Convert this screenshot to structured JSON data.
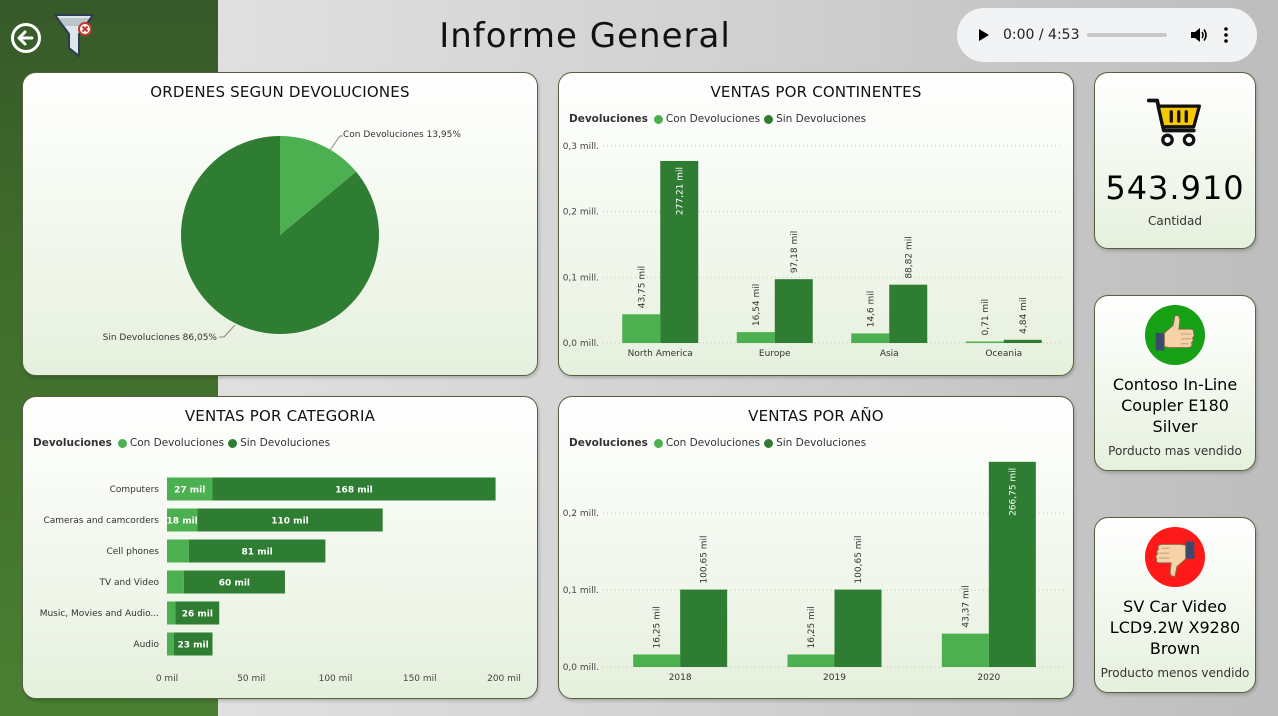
{
  "page": {
    "title": "Informe General"
  },
  "audio": {
    "time": "0:00 / 4:53",
    "progress": 0
  },
  "pie_card": {
    "title": "ORDENES SEGUN DEVOLUCIONES",
    "label_con": "Con Devoluciones 13,95%",
    "label_sin": "Sin Devoluciones 86,05%"
  },
  "continent_card": {
    "title": "VENTAS POR CONTINENTES",
    "legend_title": "Devoluciones",
    "legend_con": "Con Devoluciones",
    "legend_sin": "Sin Devoluciones",
    "y_ticks": [
      "0,0 mill.",
      "0,1 mill.",
      "0,2 mill.",
      "0,3 mill."
    ]
  },
  "category_card": {
    "title": "VENTAS POR CATEGORIA",
    "legend_title": "Devoluciones",
    "legend_con": "Con Devoluciones",
    "legend_sin": "Sin Devoluciones",
    "x_ticks": [
      "0 mil",
      "50 mil",
      "100 mil",
      "150 mil",
      "200 mil"
    ]
  },
  "year_card": {
    "title": "VENTAS POR AÑO",
    "legend_title": "Devoluciones",
    "legend_con": "Con Devoluciones",
    "legend_sin": "Sin Devoluciones",
    "y_ticks": [
      "0,0 mill.",
      "0,1 mill.",
      "0,2 mill."
    ]
  },
  "kpi_quantity": {
    "value": "543.910",
    "caption": "Cantidad"
  },
  "kpi_best": {
    "name": "Contoso In-Line Coupler E180 Silver",
    "caption": "Porducto mas vendido"
  },
  "kpi_worst": {
    "name": "SV Car Video LCD9.2W X9280 Brown",
    "caption": "Producto menos vendido"
  },
  "colors": {
    "con": "#4caf50",
    "sin": "#2e7d32",
    "band": "#3f6b2b"
  },
  "chart_data": [
    {
      "type": "pie",
      "title": "ORDENES SEGUN DEVOLUCIONES",
      "labels": [
        "Con Devoluciones",
        "Sin Devoluciones"
      ],
      "values": [
        13.95,
        86.05
      ]
    },
    {
      "type": "bar",
      "title": "VENTAS POR CONTINENTES",
      "categories": [
        "North America",
        "Europe",
        "Asia",
        "Oceania"
      ],
      "series": [
        {
          "name": "Con Devoluciones",
          "values": [
            43.75,
            16.54,
            14.6,
            0.71
          ],
          "labels": [
            "43,75 mil",
            "16,54 mil",
            "14,6 mil",
            "0,71 mil"
          ]
        },
        {
          "name": "Sin Devoluciones",
          "values": [
            277.21,
            97.18,
            88.82,
            4.84
          ],
          "labels": [
            "277,21 mil",
            "97,18 mil",
            "88,82 mil",
            "4,84 mil"
          ]
        }
      ],
      "ylim": [
        0,
        300
      ],
      "grid": true,
      "legend": "top-left"
    },
    {
      "type": "bar",
      "orientation": "horizontal",
      "stacked": true,
      "title": "VENTAS POR CATEGORIA",
      "categories": [
        "Computers",
        "Cameras and camcorders",
        "Cell phones",
        "TV and Video",
        "Music, Movies and Audio...",
        "Audio"
      ],
      "series": [
        {
          "name": "Con Devoluciones",
          "values": [
            27,
            18,
            13,
            10,
            5,
            4
          ],
          "labels": [
            "27 mil",
            "18 mil",
            "",
            "",
            "",
            ""
          ]
        },
        {
          "name": "Sin Devoluciones",
          "values": [
            168,
            110,
            81,
            60,
            26,
            23
          ],
          "labels": [
            "168 mil",
            "110 mil",
            "81 mil",
            "60 mil",
            "26 mil",
            "23 mil"
          ]
        }
      ],
      "xlim": [
        0,
        200
      ],
      "legend": "top-left"
    },
    {
      "type": "bar",
      "title": "VENTAS POR AÑO",
      "categories": [
        "2018",
        "2019",
        "2020"
      ],
      "series": [
        {
          "name": "Con Devoluciones",
          "values": [
            16.25,
            16.25,
            43.37
          ],
          "labels": [
            "16,25 mil",
            "16,25 mil",
            "43,37 mil"
          ]
        },
        {
          "name": "Sin Devoluciones",
          "values": [
            100.65,
            100.65,
            266.75
          ],
          "labels": [
            "100,65 mil",
            "100,65 mil",
            "266,75 mil"
          ]
        }
      ],
      "ylim": [
        0,
        260
      ],
      "grid": true,
      "legend": "top-left"
    }
  ]
}
